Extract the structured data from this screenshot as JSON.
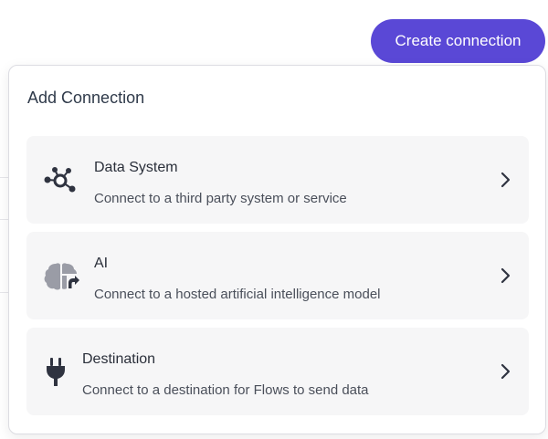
{
  "header": {
    "create_button_label": "Create connection"
  },
  "popover": {
    "title": "Add Connection",
    "options": [
      {
        "title": "Data System",
        "description": "Connect to a third party system or service",
        "icon": "network-nodes-icon"
      },
      {
        "title": "AI",
        "description": "Connect to a hosted artificial intelligence model",
        "icon": "brain-arrow-icon"
      },
      {
        "title": "Destination",
        "description": "Connect to a destination for Flows to send data",
        "icon": "plug-icon"
      }
    ]
  },
  "colors": {
    "accent": "#5a48d6",
    "card_background": "#f6f6f7",
    "icon": "#2f3340"
  }
}
